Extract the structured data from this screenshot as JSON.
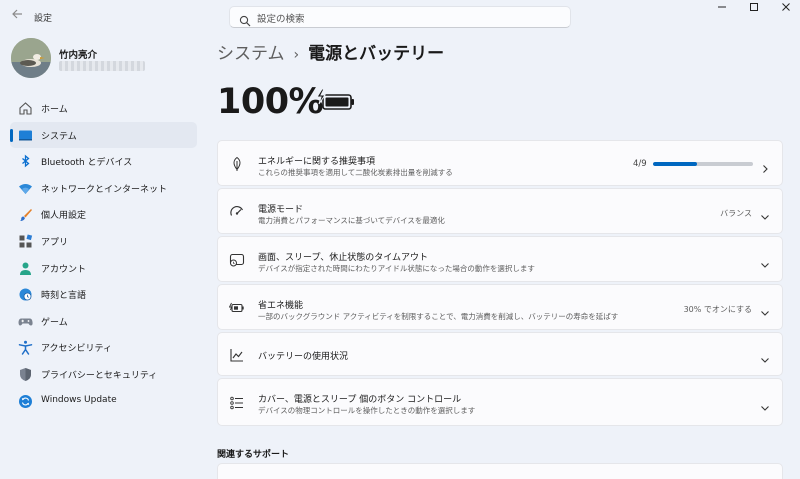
{
  "titlebar": {
    "back_icon": "back-arrow-icon",
    "app_title": "設定",
    "search_placeholder": "設定の検索",
    "window_controls": [
      "minimize-icon",
      "maximize-icon",
      "close-icon"
    ]
  },
  "profile": {
    "name": "竹内亮介"
  },
  "nav": {
    "items": [
      {
        "label": "ホーム",
        "icon": "home-icon",
        "active": false
      },
      {
        "label": "システム",
        "icon": "monitor-icon",
        "active": true
      },
      {
        "label": "Bluetooth とデバイス",
        "icon": "bluetooth-icon",
        "active": false
      },
      {
        "label": "ネットワークとインターネット",
        "icon": "wifi-icon",
        "active": false
      },
      {
        "label": "個人用設定",
        "icon": "brush-icon",
        "active": false
      },
      {
        "label": "アプリ",
        "icon": "apps-icon",
        "active": false
      },
      {
        "label": "アカウント",
        "icon": "person-icon",
        "active": false
      },
      {
        "label": "時刻と言語",
        "icon": "globe-clock-icon",
        "active": false
      },
      {
        "label": "ゲーム",
        "icon": "gamepad-icon",
        "active": false
      },
      {
        "label": "アクセシビリティ",
        "icon": "accessibility-icon",
        "active": false
      },
      {
        "label": "プライバシーとセキュリティ",
        "icon": "shield-icon",
        "active": false
      },
      {
        "label": "Windows Update",
        "icon": "update-icon",
        "active": false
      }
    ]
  },
  "main": {
    "breadcrumb_parent": "システム",
    "breadcrumb_current": "電源とバッテリー",
    "battery_percent": "100%",
    "battery_fill": 1.0,
    "cards": [
      {
        "title": "エネルギーに関する推奨事項",
        "subtitle": "これらの推奨事項を適用して二酸化炭素排出量を削減する",
        "icon": "leaf-icon",
        "progress_text": "4/9",
        "progress": 0.444,
        "chevron": "chevron-right-icon"
      },
      {
        "title": "電源モード",
        "subtitle": "電力消費とパフォーマンスに基づいてデバイスを最適化",
        "icon": "power-mode-icon",
        "value": "バランス",
        "chevron": "chevron-down-icon"
      },
      {
        "title": "画面、スリープ、休止状態のタイムアウト",
        "subtitle": "デバイスが指定された時間にわたりアイドル状態になった場合の動作を選択します",
        "icon": "screen-sleep-icon",
        "chevron": "chevron-down-icon"
      },
      {
        "title": "省エネ機能",
        "subtitle": "一部のバックグラウンド アクティビティを制限することで、電力消費を削減し、バッテリーの寿命を延ばす",
        "icon": "battery-saver-icon",
        "value": "30% でオンにする",
        "chevron": "chevron-down-icon"
      },
      {
        "title": "バッテリーの使用状況",
        "icon": "usage-chart-icon",
        "chevron": "chevron-down-icon"
      },
      {
        "title": "カバー、電源とスリープ 個のボタン コントロール",
        "subtitle": "デバイスの物理コントロールを操作したときの動作を選択します",
        "icon": "list-controls-icon",
        "chevron": "chevron-down-icon"
      }
    ],
    "related_support": "関連するサポート"
  }
}
